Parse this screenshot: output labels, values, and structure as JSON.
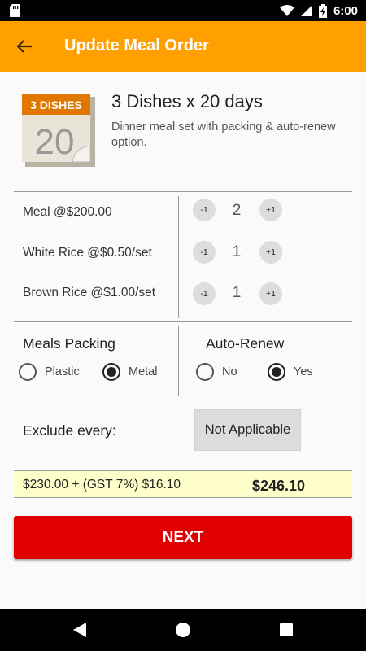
{
  "status_bar": {
    "time": "6:00",
    "icons": [
      "sd-card-icon",
      "wifi-icon",
      "cell-signal-icon",
      "battery-charging-icon"
    ]
  },
  "app_bar": {
    "title": "Update Meal Order",
    "back_icon": "arrow-back-icon",
    "color": "#ff9f00"
  },
  "plan": {
    "icon_top_text": "3 DISHES",
    "icon_number": "20",
    "title": "3 Dishes x 20 days",
    "description": "Dinner meal set with packing & auto-renew option."
  },
  "items": [
    {
      "label": "Meal @$200.00",
      "minus": "-1",
      "qty": "2",
      "plus": "+1"
    },
    {
      "label": "White Rice @$0.50/set",
      "minus": "-1",
      "qty": "1",
      "plus": "+1"
    },
    {
      "label": "Brown Rice @$1.00/set",
      "minus": "-1",
      "qty": "1",
      "plus": "+1"
    }
  ],
  "packing": {
    "title": "Meals Packing",
    "options": [
      {
        "label": "Plastic",
        "checked": false
      },
      {
        "label": "Metal",
        "checked": true
      }
    ]
  },
  "auto_renew": {
    "title": "Auto-Renew",
    "options": [
      {
        "label": "No",
        "checked": false
      },
      {
        "label": "Yes",
        "checked": true
      }
    ]
  },
  "exclude": {
    "label": "Exclude every:",
    "value": "Not Applicable"
  },
  "totals": {
    "subtotal": "$230.00 + (GST 7%) $16.10",
    "grand_total": "$246.10",
    "background": "#ffffcc"
  },
  "next_button": {
    "label": "NEXT",
    "color": "#e00000"
  },
  "nav_bar": {
    "icons": [
      "back-triangle-icon",
      "home-circle-icon",
      "recents-square-icon"
    ]
  }
}
